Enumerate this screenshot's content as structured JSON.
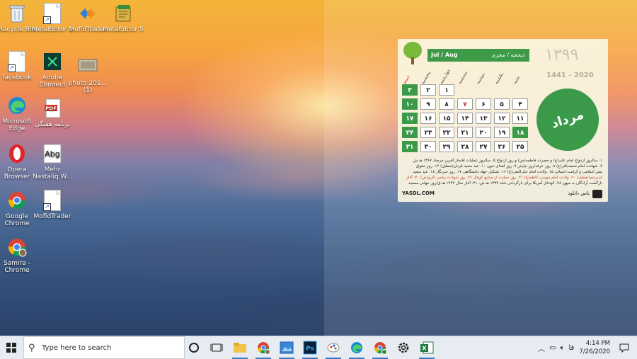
{
  "desktop": {
    "icons": [
      {
        "label": "Recycle Bin",
        "icon": "recycle-bin-icon"
      },
      {
        "label": "MetaEditor 5",
        "icon": "document-icon"
      },
      {
        "label": "MofidTrader",
        "icon": "mofid-trader-icon"
      },
      {
        "label": "MetaEditor 5",
        "icon": "metaeditor-icon"
      },
      {
        "label": "facebook",
        "icon": "document-icon"
      },
      {
        "label": "Adobe Connect",
        "icon": "adobe-connect-icon"
      },
      {
        "label": "photo 201... (1)",
        "icon": "photo-icon"
      },
      {
        "label": "Microsoft Edge",
        "icon": "edge-icon"
      },
      {
        "label": "برنامه هفتگی",
        "icon": "pdf-icon"
      },
      {
        "label": "Opera Browser",
        "icon": "opera-icon"
      },
      {
        "label": "Mehr Nastaliq W...",
        "icon": "font-file-icon"
      },
      {
        "label": "Google Chrome",
        "icon": "chrome-icon"
      },
      {
        "label": "MofidTrader",
        "icon": "document-icon"
      },
      {
        "label": "Samira - Chrome",
        "icon": "chrome-profile-icon"
      }
    ]
  },
  "calendar": {
    "header_en": "Jul / Aug",
    "header_fa": "ذیحجه / محرم",
    "year_fa": "۱۳۹۹",
    "year_en": "1441 - 2020",
    "month_name": "مرداد",
    "daynames": [
      "جمعه",
      "پنجشنبه",
      "چهارشنبه",
      "سه‌شنبه",
      "دوشنبه",
      "یکشنبه",
      "شنبه"
    ],
    "rows": [
      [
        "۳",
        "۲",
        "۱",
        "",
        "",
        "",
        ""
      ],
      [
        "۱۰",
        "۹",
        "۸",
        "۷",
        "۶",
        "۵",
        "۴"
      ],
      [
        "۱۷",
        "۱۶",
        "۱۵",
        "۱۴",
        "۱۳",
        "۱۲",
        "۱۱"
      ],
      [
        "۲۴",
        "۲۳",
        "۲۲",
        "۲۱",
        "۲۰",
        "۱۹",
        "۱۸"
      ],
      [
        "۳۱",
        "۳۰",
        "۲۹",
        "۲۸",
        "۲۷",
        "۲۶",
        "۲۵"
      ]
    ],
    "events_1": "۱. سالروز ازدواج امام علی(ع) و حضرت فاطمه(س) و روز ازدواج ۵. سالروز عملیات افتخار آفرین مرصاد ۱۳۶۷ هـ.ش",
    "events_2": "۷. شهادت امام محمدباقر(ع) ۸. روز عرفه/روز نیایش ۹. روز اهدای خون ۱۰. عید سعید قربان(تعطیل) ۱۴. روز حقوق",
    "events_3": "بشر اسلامی و کرامت انسانی ۱۵. ولادت امام علی‌النقی(ع) ۱۶. تشکیل جهاد دانشگاهی ۱۷. روز خبرنگار ۱۸. عید سعید",
    "events_4": "غدیرخم(تعطیل) ۲۰. ولادت امام موسی کاظم(ع) ۲۱. روز حمایت از صنایع کوچک ۲۶. روز شهادت پیامبر اکرم(ص) ۳۰. آغاز",
    "events_5": "بازگشت آزادگان به میهن ۲۸. کودتای آمریکا برای بازگردانی شاه ۱۳۳۲ هـ.ش، ۳۱. آغاز سال ۱۴۴۲ هـ.ق/روز جهانی مسجد",
    "site": "YASDL.COM",
    "brand": "یاس دانلود"
  },
  "taskbar": {
    "search_placeholder": "Type here to search",
    "lang": "فا",
    "time": "4:14 PM",
    "date": "7/26/2020",
    "pinned": [
      "task-view-icon",
      "file-explorer-icon",
      "chrome-icon",
      "photos-icon",
      "photoshop-icon",
      "paint-icon",
      "edge-icon",
      "chrome-profile-icon",
      "settings-icon",
      "excel-icon"
    ]
  }
}
